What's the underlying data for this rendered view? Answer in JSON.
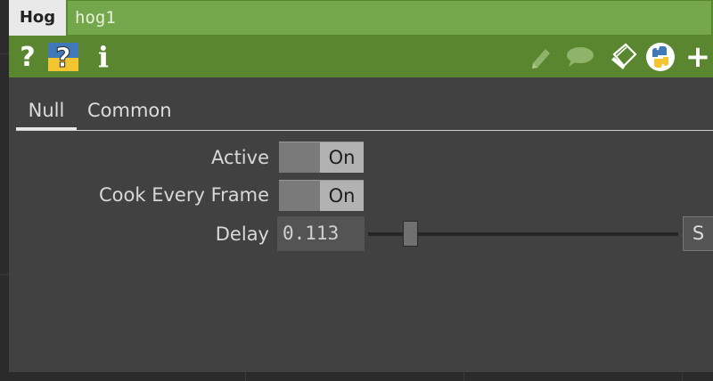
{
  "window": {
    "op_type": "Hog",
    "op_name": "hog1"
  },
  "toolbar": {
    "icons": [
      "help-icon",
      "python-help-icon",
      "info-icon",
      "edit-icon",
      "comment-icon",
      "clipboard-icon",
      "python-icon",
      "add-icon"
    ],
    "help_glyph": "?",
    "info_glyph": "i",
    "add_glyph": "+"
  },
  "tabs": [
    {
      "label": "Null",
      "active": true
    },
    {
      "label": "Common",
      "active": false
    }
  ],
  "params": {
    "active": {
      "label": "Active",
      "value": "On"
    },
    "cook_every_frame": {
      "label": "Cook Every Frame",
      "value": "On"
    },
    "delay": {
      "label": "Delay",
      "value": "0.113",
      "slider_fraction": 0.113,
      "extra_button": "S"
    }
  },
  "colors": {
    "titlebar": "#59862f",
    "name_field": "#74a64c",
    "panel": "#414141"
  }
}
